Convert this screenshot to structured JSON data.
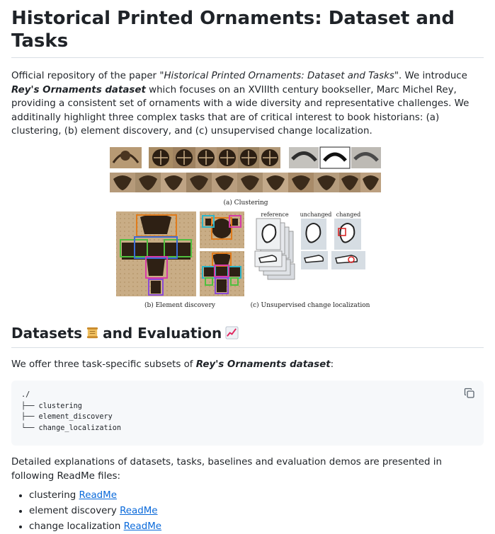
{
  "title": "Historical Printed Ornaments: Dataset and Tasks",
  "intro": {
    "p1": "Official repository of the paper ",
    "paper_title": "\"Historical Printed Ornaments: Dataset and Tasks\"",
    "p2": ". We introduce ",
    "dataset_name": "Rey's Ornaments dataset",
    "p3": " which focuses on an XVIIIth century bookseller, Marc Michel Rey, providing a consistent set of ornaments with a wide diversity and representative challenges. We additinally highlight three complex tasks that are of critical interest to book historians: (a) clustering, (b) element discovery, and (c) unsupervised change localization."
  },
  "figure": {
    "caption_a": "(a) Clustering",
    "caption_b": "(b) Element discovery",
    "caption_c": "(c) Unsupervised change localization",
    "col_reference": "reference",
    "col_unchanged": "unchanged",
    "col_changed": "changed"
  },
  "datasets_section": {
    "heading_part1": "Datasets",
    "heading_part2": "and Evaluation",
    "emoji1": "scroll-emoji-icon",
    "emoji2": "chart-increasing-emoji-icon",
    "offer_p1": "We offer three task-specific subsets of ",
    "offer_name": "Rey's Ornaments dataset",
    "offer_p2": ":",
    "code_lines": [
      "./",
      "├── clustering",
      "├── element_discovery",
      "└── change_localization"
    ],
    "detail": "Detailed explanations of datasets, tasks, baselines and evaluation demos are presented in following ReadMe files:",
    "list": [
      {
        "label": "clustering ",
        "link": "ReadMe"
      },
      {
        "label": "element discovery ",
        "link": "ReadMe"
      },
      {
        "label": "change localization ",
        "link": "ReadMe"
      }
    ]
  },
  "colors": {
    "link": "#0969da",
    "text": "#1f2328",
    "code_bg": "#f6f8fa",
    "border": "#d8dee4"
  }
}
